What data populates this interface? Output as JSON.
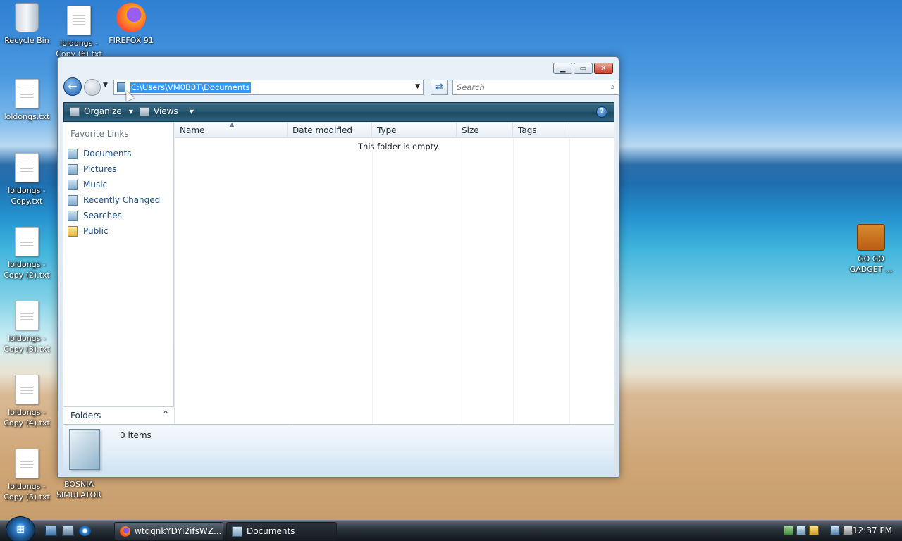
{
  "desktop": {
    "icons": [
      {
        "label": "Recycle Bin"
      },
      {
        "label": "loldongs - Copy (6).txt"
      },
      {
        "label": "FIREFOX 91"
      },
      {
        "label": "loldongs.txt"
      },
      {
        "label": "loldongs - Copy.txt"
      },
      {
        "label": "loldongs - Copy (2).txt"
      },
      {
        "label": "loldongs - Copy (3).txt"
      },
      {
        "label": "loldongs - Copy (4).txt"
      },
      {
        "label": "loldongs - Copy (5).txt"
      },
      {
        "label": "BOSNIA SIMULATOR"
      },
      {
        "label": "GO GO GADGET ..."
      }
    ]
  },
  "window": {
    "caption": {
      "minimize": "▁",
      "maximize": "▭",
      "close": "✕"
    },
    "nav": {
      "back_glyph": "←",
      "recent_glyph": "▼"
    },
    "address": {
      "path": "C:\\Users\\VM0B0T\\Documents",
      "drop_glyph": "▼"
    },
    "refresh_glyph": "⇄",
    "search": {
      "placeholder": "Search",
      "icon_glyph": "⌕"
    },
    "commandbar": {
      "organize": "Organize",
      "views": "Views",
      "arrow": "▼",
      "help": "?"
    },
    "favorites": {
      "title": "Favorite Links",
      "items": [
        {
          "label": "Documents"
        },
        {
          "label": "Pictures"
        },
        {
          "label": "Music"
        },
        {
          "label": "Recently Changed"
        },
        {
          "label": "Searches"
        },
        {
          "label": "Public"
        }
      ]
    },
    "folders": {
      "label": "Folders",
      "chevron": "⌃"
    },
    "columns": [
      "Name",
      "Date modified",
      "Type",
      "Size",
      "Tags"
    ],
    "sort_glyph": "▲",
    "empty_message": "This folder is empty.",
    "details": {
      "items_count": "0 items"
    }
  },
  "taskbar": {
    "start_glyph": "⊞",
    "tasks": [
      {
        "label": "wtqqnkYDYi2ifsWZ..."
      },
      {
        "label": "Documents"
      }
    ],
    "clock": "12:37 PM"
  }
}
